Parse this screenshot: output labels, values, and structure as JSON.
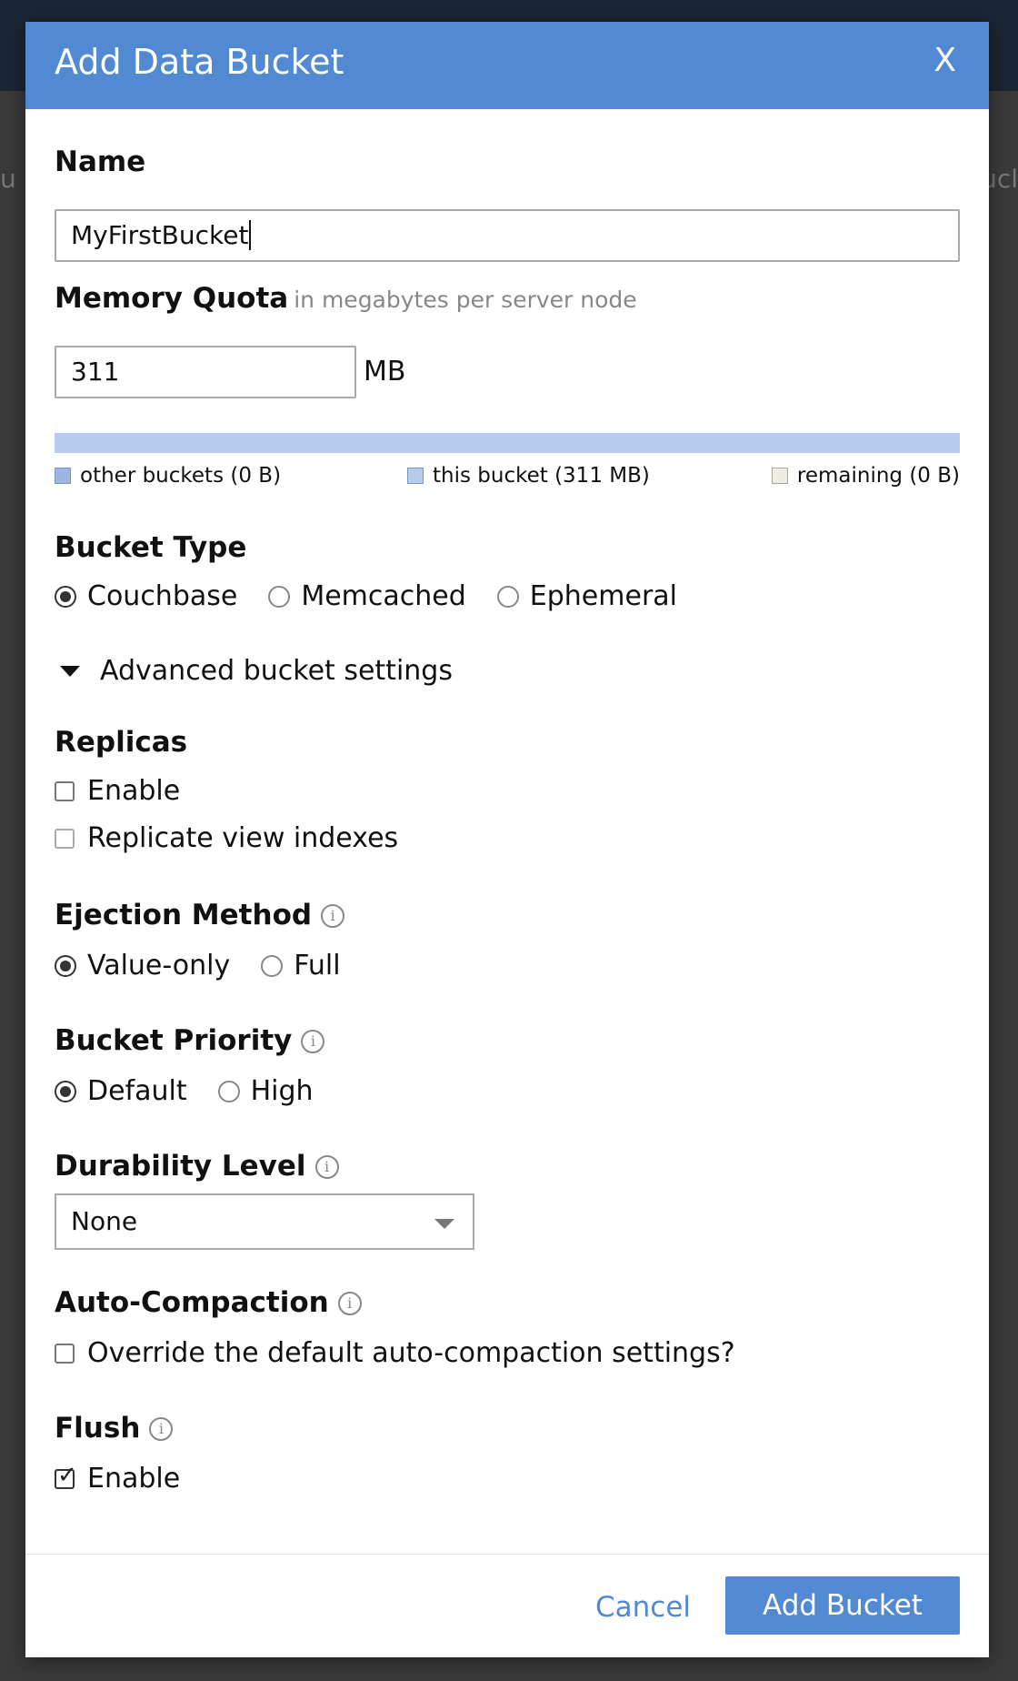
{
  "background": {
    "left_text": "u h",
    "right_text": "ucl"
  },
  "modal": {
    "title": "Add Data Bucket",
    "close_label": "X"
  },
  "name": {
    "label": "Name",
    "value": "MyFirstBucket"
  },
  "memory_quota": {
    "label": "Memory Quota",
    "hint": "in megabytes per server node",
    "value": "311",
    "unit": "MB",
    "legend": {
      "other": "other buckets (0 B)",
      "this": "this bucket (311 MB)",
      "remaining": "remaining (0 B)"
    },
    "this_bucket_fraction": 1.0
  },
  "bucket_type": {
    "label": "Bucket Type",
    "options": [
      "Couchbase",
      "Memcached",
      "Ephemeral"
    ],
    "selected": "Couchbase"
  },
  "advanced": {
    "label": "Advanced bucket settings"
  },
  "replicas": {
    "label": "Replicas",
    "enable_label": "Enable",
    "replicate_label": "Replicate view indexes"
  },
  "ejection": {
    "label": "Ejection Method",
    "options": [
      "Value-only",
      "Full"
    ],
    "selected": "Value-only"
  },
  "priority": {
    "label": "Bucket Priority",
    "options": [
      "Default",
      "High"
    ],
    "selected": "Default"
  },
  "durability": {
    "label": "Durability Level",
    "value": "None"
  },
  "compaction": {
    "label": "Auto-Compaction",
    "override_label": "Override the default auto-compaction settings?"
  },
  "flush": {
    "label": "Flush",
    "enable_label": "Enable",
    "checked": true
  },
  "footer": {
    "cancel_label": "Cancel",
    "add_label": "Add Bucket"
  },
  "colors": {
    "header": "#5189d3",
    "bar": "#b6ccee",
    "primary_button": "#5189d3"
  },
  "icons": {
    "info": "info-icon",
    "caret": "caret-down-icon"
  }
}
